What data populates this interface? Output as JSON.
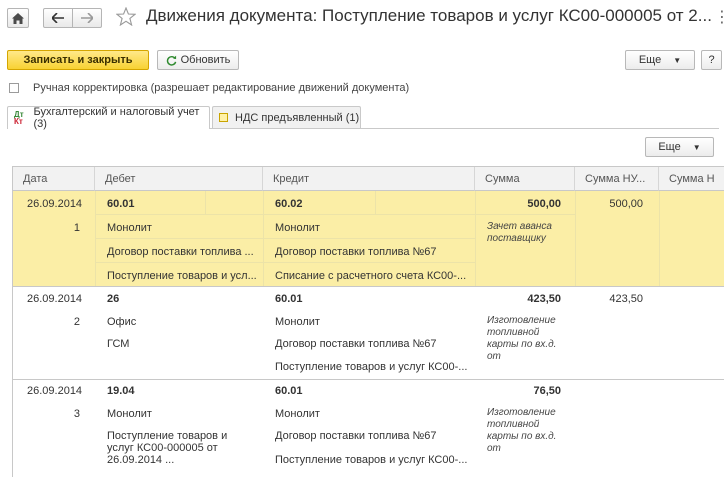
{
  "header": {
    "title": "Движения документа: Поступление товаров и услуг КС00-000005 от 2...",
    "more_label": "⋮"
  },
  "toolbar": {
    "save_close_label": "Записать и закрыть",
    "refresh_label": "Обновить",
    "more_label": "Еще",
    "help_label": "?"
  },
  "manual_correction": {
    "label": "Ручная корректировка (разрешает редактирование движений документа)",
    "checked": false
  },
  "tabs": [
    {
      "label": "Бухгалтерский и налоговый учет (3)",
      "active": true
    },
    {
      "label": "НДС предъявленный (1)",
      "active": false
    }
  ],
  "table_toolbar": {
    "more_label": "Еще"
  },
  "table": {
    "columns": [
      "Дата",
      "Дебет",
      "Кредит",
      "Сумма",
      "Сумма НУ...",
      "Сумма Н"
    ],
    "rows": [
      {
        "date": "26.09.2014",
        "num": "1",
        "debit": [
          "60.01",
          "Монолит",
          "Договор поставки топлива ...",
          "Поступление товаров и усл..."
        ],
        "credit": [
          "60.02",
          "Монолит",
          "Договор поставки топлива №67",
          "Списание с расчетного счета КС00-..."
        ],
        "sum": "500,00",
        "sum_nu": "500,00",
        "content": "Зачет аванса поставщику"
      },
      {
        "date": "26.09.2014",
        "num": "2",
        "debit": [
          "26",
          "Офис",
          "ГСМ",
          ""
        ],
        "credit": [
          "60.01",
          "Монолит",
          "Договор поставки топлива №67",
          "Поступление товаров и услуг КС00-..."
        ],
        "sum": "423,50",
        "sum_nu": "423,50",
        "content": "Изготовление топливной карты по вх.д. от"
      },
      {
        "date": "26.09.2014",
        "num": "3",
        "debit": [
          "19.04",
          "Монолит",
          "Поступление товаров и услуг КС00-000005 от 26.09.2014 ...",
          ""
        ],
        "credit": [
          "60.01",
          "Монолит",
          "Договор поставки топлива №67",
          "Поступление товаров и услуг КС00-..."
        ],
        "sum": "76,50",
        "sum_nu": "",
        "content": "Изготовление топливной карты по вх.д. от"
      }
    ]
  },
  "colors": {
    "accent": "#f8d233",
    "selected_row": "#fbeea6",
    "header_bg": "#f2f2f2"
  }
}
